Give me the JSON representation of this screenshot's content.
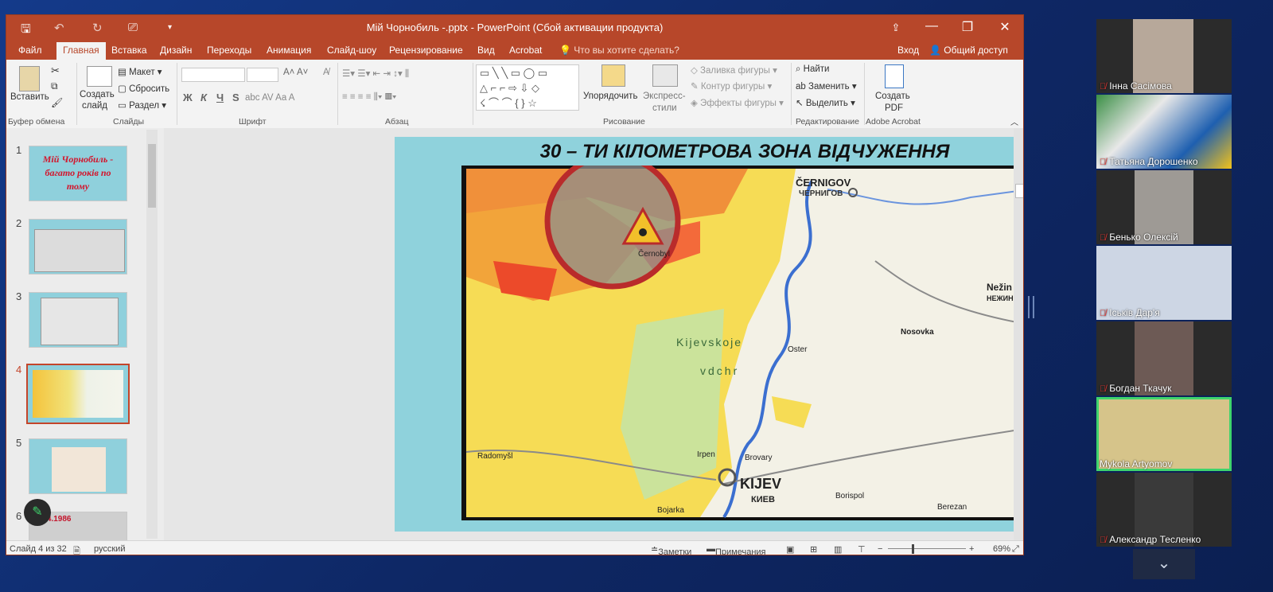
{
  "window": {
    "title": "Мій Чорнобиль -.pptx - PowerPoint (Сбой активации продукта)"
  },
  "tabs": [
    "Файл",
    "Главная",
    "Вставка",
    "Дизайн",
    "Переходы",
    "Анимация",
    "Слайд-шоу",
    "Рецензирование",
    "Вид",
    "Acrobat"
  ],
  "active_tab": "Главная",
  "tell_me": "Что вы хотите сделать?",
  "sign_in": "Вход",
  "share": "Общий доступ",
  "ribbon": {
    "clipboard": {
      "paste": "Вставить",
      "group": "Буфер обмена"
    },
    "slides": {
      "new_slide_line1": "Создать",
      "new_slide_line2": "слайд",
      "layout": "Макет",
      "reset": "Сбросить",
      "section": "Раздел",
      "group": "Слайды"
    },
    "font": {
      "bold": "Ж",
      "italic": "К",
      "underline": "Ч",
      "strike": "S",
      "group": "Шрифт"
    },
    "paragraph": {
      "group": "Абзац"
    },
    "drawing": {
      "arrange": "Упорядочить",
      "quick_styles_line1": "Экспресс-",
      "quick_styles_line2": "стили",
      "shape_fill": "Заливка фигуры",
      "shape_outline": "Контур фигуры",
      "shape_effects": "Эффекты фигуры",
      "group": "Рисование"
    },
    "editing": {
      "find": "Найти",
      "replace": "Заменить",
      "select": "Выделить",
      "group": "Редактирование"
    },
    "acrobat": {
      "create_pdf_line1": "Создать",
      "create_pdf_line2": "PDF",
      "group": "Adobe Acrobat"
    }
  },
  "thumbnails": [
    {
      "num": "1",
      "text": "Мій Чорнобиль - багато років по тому"
    },
    {
      "num": "2",
      "text": ""
    },
    {
      "num": "3",
      "text": ""
    },
    {
      "num": "4",
      "text": ""
    },
    {
      "num": "5",
      "text": ""
    },
    {
      "num": "6",
      "text": "6.04.1986"
    }
  ],
  "selected_slide": "4",
  "slide": {
    "title": "30 – ТИ КІЛОМЕТРОВА ЗОНА ВІДЧУЖЕННЯ",
    "map_labels": {
      "cernigov": "ČERNIGOV",
      "cernigov_cyr": "ЧЕРНИГОВ",
      "chernobyl": "Černobyl",
      "kijevskoje1": "Kijevskoje",
      "kijevskoje2": "vdchr",
      "kijev": "KIJEV",
      "kijev_cyr": "КИЕВ",
      "nezin": "Nežin",
      "nezin_cyr": "НЕЖИН",
      "nosovka": "Nosovka",
      "oster": "Oster",
      "brovary": "Brovary",
      "borispol": "Borispol",
      "radomysl": "Radomyšl",
      "bojarka": "Bojarka",
      "irpen": "Irpen",
      "berezan": "Berezan"
    }
  },
  "status": {
    "slide_info": "Слайд 4 из 32",
    "language": "русский",
    "notes": "Заметки",
    "comments": "Примечания",
    "zoom": "69%"
  },
  "participants": [
    {
      "name": "Інна Сасімова",
      "muted": true
    },
    {
      "name": "Татьяна Дорошенко",
      "muted": true
    },
    {
      "name": "Бенько Олексій",
      "muted": true
    },
    {
      "name": "Іськів Дар'я",
      "muted": true
    },
    {
      "name": "Богдан Ткачук",
      "muted": true
    },
    {
      "name": "Mykola Artyomov",
      "muted": false
    },
    {
      "name": "Александр Тесленко",
      "muted": true
    }
  ],
  "colors": {
    "ppt_accent": "#b7472a",
    "active_speaker": "#3fd46c",
    "slide_bg": "#8fd2dc"
  }
}
